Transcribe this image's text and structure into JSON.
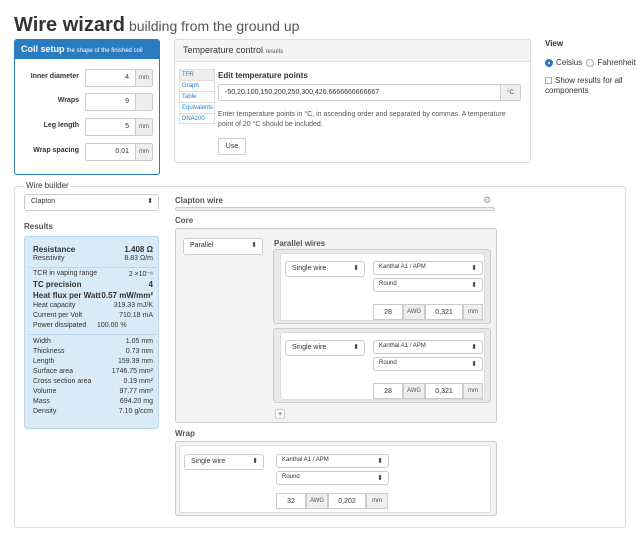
{
  "header": {
    "title": "Wire wizard",
    "subtitle": "building from the ground up"
  },
  "coil": {
    "title": "Coil setup",
    "subtitle": "the shape of the finished coil",
    "inner_diameter": {
      "label": "Inner diameter",
      "value": "4",
      "unit": "mm"
    },
    "wraps": {
      "label": "Wraps",
      "value": "9",
      "unit": ""
    },
    "leg_length": {
      "label": "Leg length",
      "value": "5",
      "unit": "mm"
    },
    "wrap_spacing": {
      "label": "Wrap spacing",
      "value": "0.01",
      "unit": "mm"
    }
  },
  "temp": {
    "title": "Temperature control",
    "subtitle": "results",
    "tabs": [
      "TFR",
      "Graph",
      "Table",
      "Equivalents",
      "DNA200"
    ],
    "edit_label": "Edit temperature points",
    "points": "-50,20,100,150,200,250,300,426.6666666666667",
    "unit": "°C",
    "help": "Enter temperature points in °C, in ascending order and separated by commas. A temperature point of 20 °C should be included.",
    "use_label": "Use"
  },
  "view": {
    "title": "View",
    "celsius": "Celsius",
    "fahrenheit": "Fahrenheit",
    "show_all": "Show results for all components"
  },
  "builder": {
    "label": "Wire builder",
    "type_select": "Clapton",
    "results_heading": "Results",
    "clapton_title": "Clapton wire",
    "core_heading": "Core",
    "core_select": "Parallel",
    "parallel_heading": "Parallel wires",
    "wrap_heading": "Wrap",
    "add_label": "+",
    "wire1": {
      "type": "Single wire",
      "material": "Kanthal A1 / APM",
      "shape": "Round",
      "awg_value": "28",
      "awg_label": "AWG",
      "mm_value": "0,321",
      "mm_unit": "mm"
    },
    "wire2": {
      "type": "Single wire",
      "material": "Kanthal A1 / APM",
      "shape": "Round",
      "awg_value": "28",
      "awg_label": "AWG",
      "mm_value": "0,321",
      "mm_unit": "mm"
    },
    "wrap_wire": {
      "type": "Single wire",
      "material": "Kanthal A1 / APM",
      "shape": "Round",
      "awg_value": "32",
      "awg_label": "AWG",
      "mm_value": "0,202",
      "mm_unit": "mm"
    }
  },
  "results": {
    "resistance": {
      "k": "Resistance",
      "v": "1.408 Ω"
    },
    "resistivity": {
      "k": "Resistivity",
      "v": "8.83 Ω/m"
    },
    "tcr": {
      "k": "TCR in vaping range",
      "v": "2 ×10⁻⁶"
    },
    "tc_precision": {
      "k": "TC precision",
      "v": "4"
    },
    "heat_flux": {
      "k": "Heat flux per Watt",
      "v": "0.57 mW/mm²"
    },
    "heat_capacity": {
      "k": "Heat capacity",
      "v": "319.33 mJ/K"
    },
    "current": {
      "k": "Current per Volt",
      "v": "710.18 mA"
    },
    "power": {
      "k": "Power dissipated",
      "v": "100.00 %"
    },
    "width": {
      "k": "Width",
      "v": "1.05 mm"
    },
    "thickness": {
      "k": "Thickness",
      "v": "0.73 mm"
    },
    "length": {
      "k": "Length",
      "v": "159.39 mm"
    },
    "surface": {
      "k": "Surface area",
      "v": "1746.75 mm²"
    },
    "cross": {
      "k": "Cross section area",
      "v": "0.19 mm²"
    },
    "volume": {
      "k": "Volume",
      "v": "97.77 mm³"
    },
    "mass": {
      "k": "Mass",
      "v": "694.20 mg"
    },
    "density": {
      "k": "Density",
      "v": "7.10 g/ccm"
    }
  }
}
